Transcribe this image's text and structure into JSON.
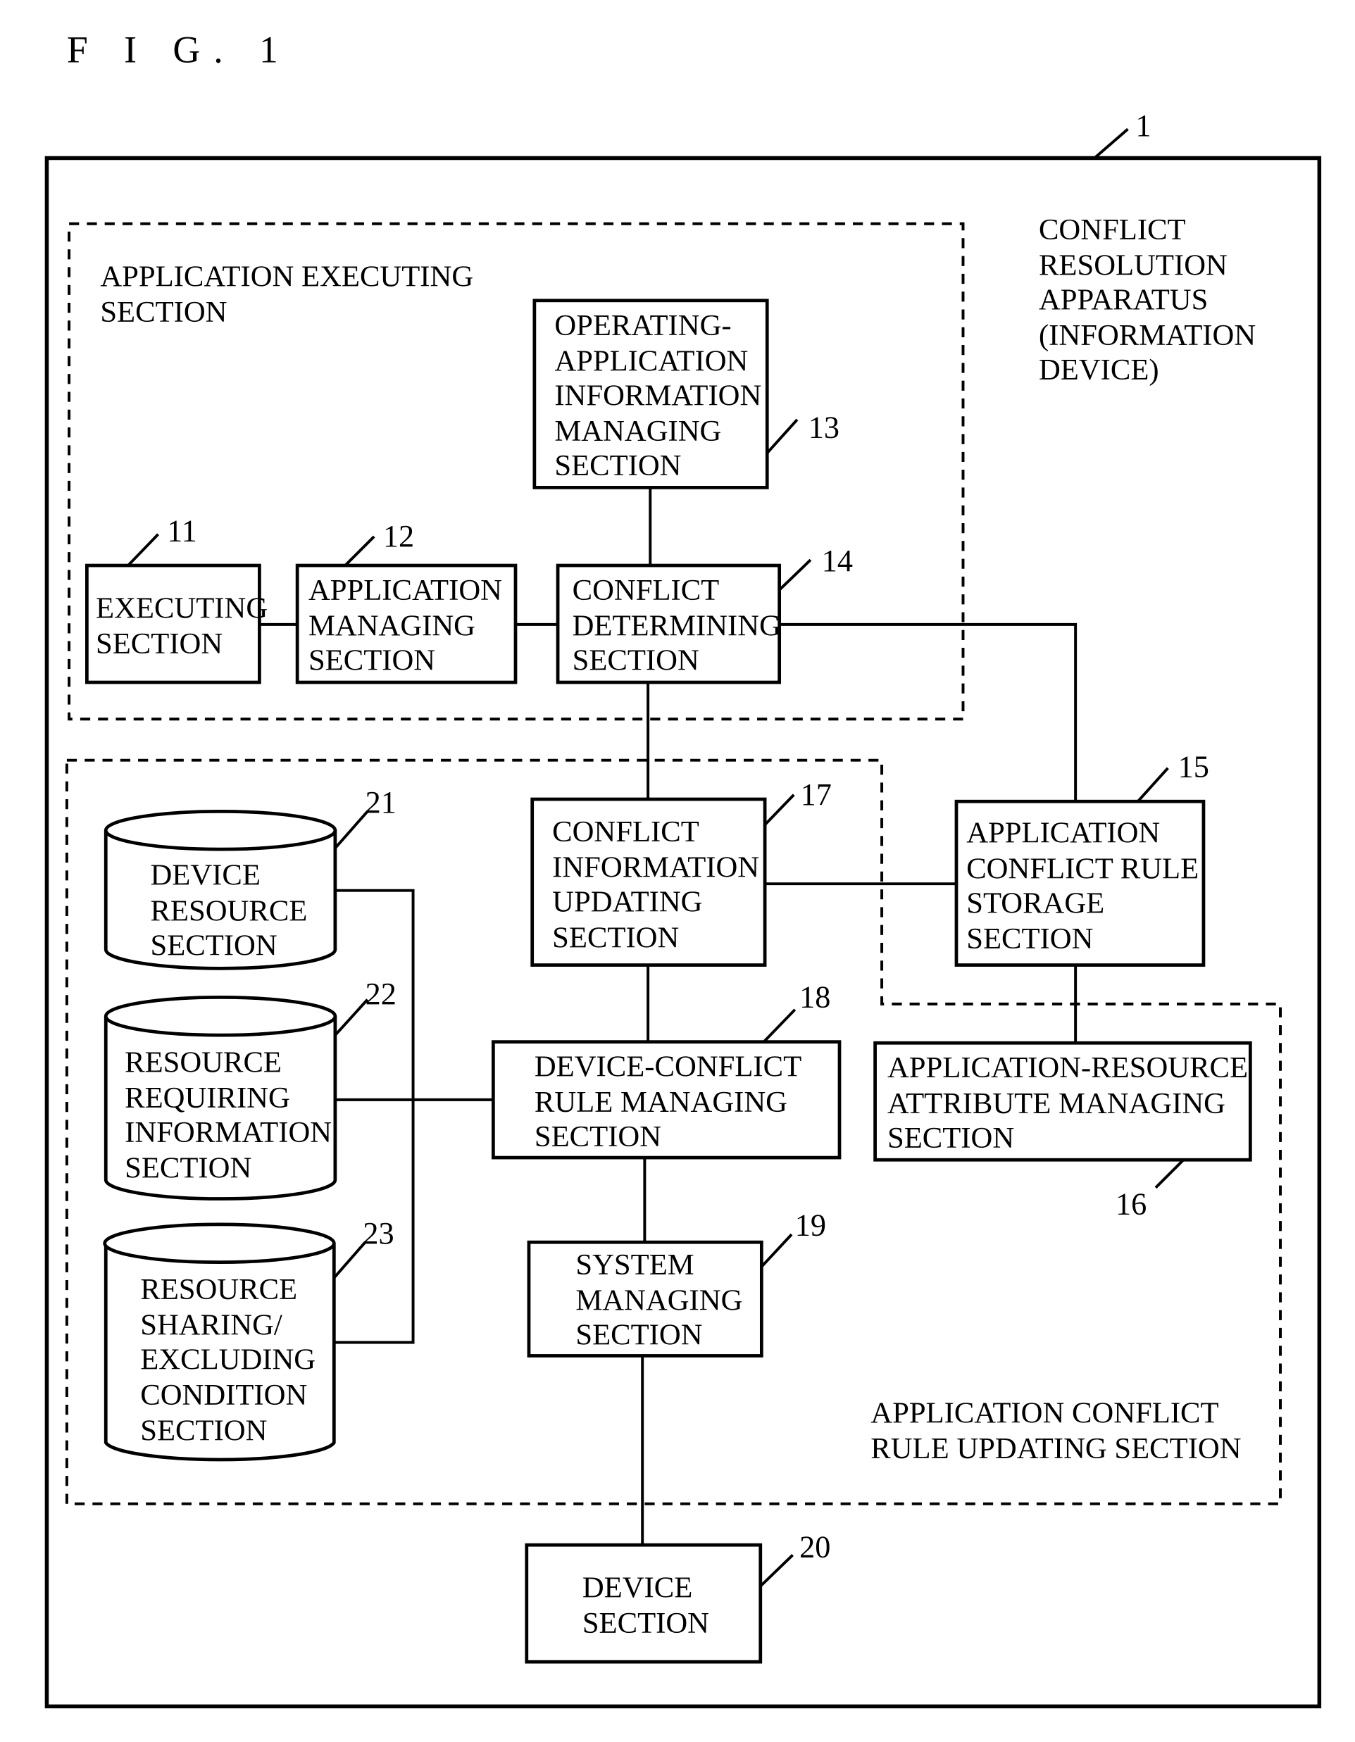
{
  "figure": {
    "title": "F I G. 1",
    "apparatus_ref": "1",
    "apparatus_label": [
      "CONFLICT",
      "RESOLUTION",
      "APPARATUS",
      "(INFORMATION",
      "DEVICE)"
    ]
  },
  "groups": {
    "app_executing": {
      "label": [
        "APPLICATION EXECUTING",
        "SECTION"
      ]
    },
    "rule_updating": {
      "label": [
        "APPLICATION CONFLICT",
        "RULE UPDATING SECTION"
      ]
    }
  },
  "blocks": {
    "b11": {
      "ref": "11",
      "lines": [
        "EXECUTING",
        "SECTION"
      ]
    },
    "b12": {
      "ref": "12",
      "lines": [
        "APPLICATION",
        "MANAGING",
        "SECTION"
      ]
    },
    "b13": {
      "ref": "13",
      "lines": [
        "OPERATING-",
        "APPLICATION",
        "INFORMATION",
        "MANAGING",
        "SECTION"
      ]
    },
    "b14": {
      "ref": "14",
      "lines": [
        "CONFLICT",
        "DETERMINING",
        "SECTION"
      ]
    },
    "b15": {
      "ref": "15",
      "lines": [
        "APPLICATION",
        "CONFLICT RULE",
        "STORAGE",
        "SECTION"
      ]
    },
    "b16": {
      "ref": "16",
      "lines": [
        "APPLICATION-RESOURCE",
        "ATTRIBUTE MANAGING",
        "SECTION"
      ]
    },
    "b17": {
      "ref": "17",
      "lines": [
        "CONFLICT",
        "INFORMATION",
        "UPDATING",
        "SECTION"
      ]
    },
    "b18": {
      "ref": "18",
      "lines": [
        "DEVICE-CONFLICT",
        "RULE MANAGING",
        "SECTION"
      ]
    },
    "b19": {
      "ref": "19",
      "lines": [
        "SYSTEM",
        "MANAGING",
        "SECTION"
      ]
    },
    "b20": {
      "ref": "20",
      "lines": [
        "DEVICE",
        "SECTION"
      ]
    }
  },
  "databases": {
    "d21": {
      "ref": "21",
      "lines": [
        "DEVICE",
        "RESOURCE",
        "SECTION"
      ]
    },
    "d22": {
      "ref": "22",
      "lines": [
        "RESOURCE",
        "REQUIRING",
        "INFORMATION",
        "SECTION"
      ]
    },
    "d23": {
      "ref": "23",
      "lines": [
        "RESOURCE",
        "SHARING/",
        "EXCLUDING",
        "CONDITION",
        "SECTION"
      ]
    }
  }
}
